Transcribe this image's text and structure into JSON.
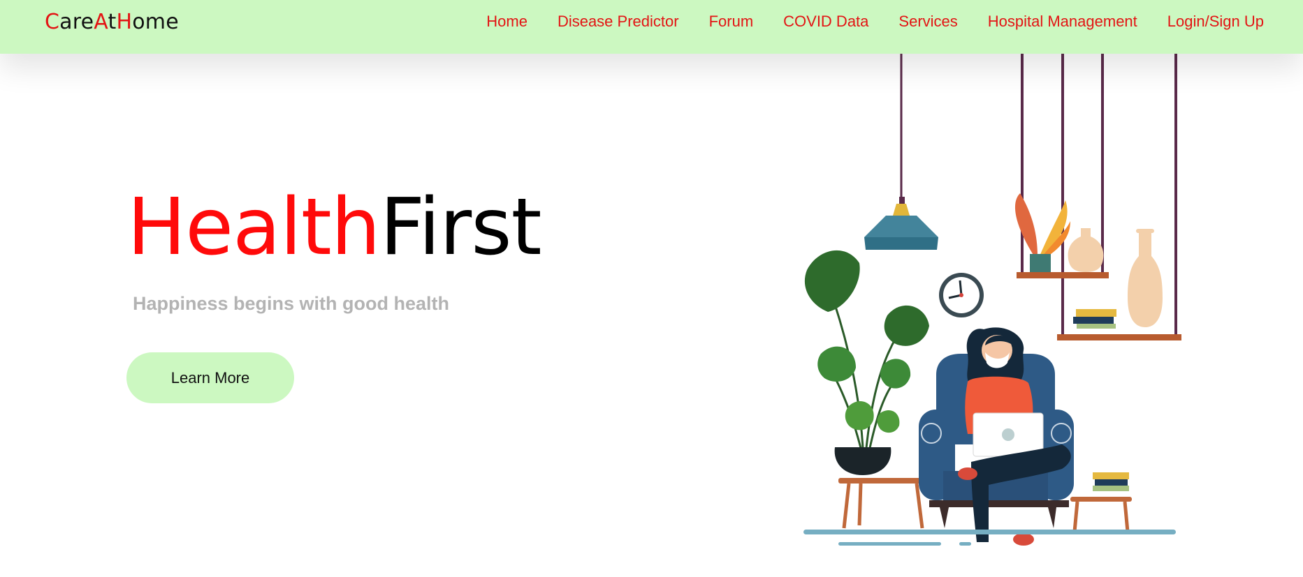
{
  "navbar": {
    "brand": [
      {
        "text": "C",
        "color": "#e31414"
      },
      {
        "text": "are",
        "color": "#111111"
      },
      {
        "text": "A",
        "color": "#e31414"
      },
      {
        "text": "t",
        "color": "#111111"
      },
      {
        "text": "H",
        "color": "#e31414"
      },
      {
        "text": "ome",
        "color": "#111111"
      }
    ],
    "links": [
      "Home",
      "Disease Predictor",
      "Forum",
      "COVID Data",
      "Services",
      "Hospital Management",
      "Login/Sign Up"
    ]
  },
  "hero": {
    "title_part1": "Health",
    "title_part2": "First",
    "subtitle": "Happiness begins with good health",
    "button_label": "Learn More"
  },
  "colors": {
    "accent_red": "#ff0a0a",
    "navbar_green": "#ccf8c1",
    "nav_link_red": "#e31414"
  }
}
